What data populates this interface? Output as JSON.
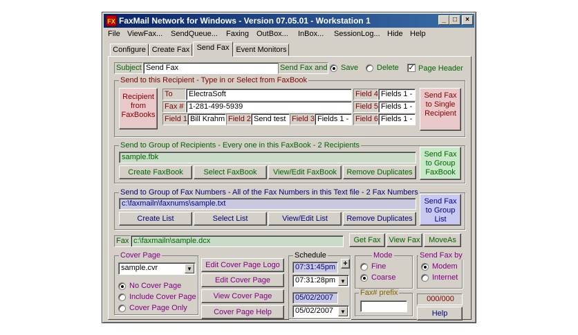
{
  "window": {
    "title": "FaxMail Network for Windows - Version 07.05.01 - Workstation 1",
    "icon": "FX"
  },
  "titlebar_buttons": {
    "minimize": "_",
    "maximize": "□",
    "close": "×"
  },
  "menu": [
    "File",
    "ViewFax...",
    "SendQueue...",
    "Faxing",
    "OutBox...",
    "InBox...",
    "SessionLog...",
    "Hide",
    "Help"
  ],
  "tabs": [
    "Configure",
    "Create Fax",
    "Send Fax",
    "Event Monitors"
  ],
  "subject": {
    "label": "Subject",
    "value": "Send Fax"
  },
  "send_fax_and": {
    "label": "Send Fax and",
    "save": "Save",
    "delete": "Delete",
    "page_header": "Page Header"
  },
  "recipient": {
    "legend": "Send to this Recipient - Type in or Select from FaxBook",
    "faxbooks_button": "Recipient from FaxBooks",
    "to_label": "To",
    "to_value": "ElectraSoft",
    "fax_label": "Fax #",
    "fax_value": "1-281-499-5939",
    "field1_label": "Field 1",
    "field1_value": "Bill Krahm",
    "field2_label": "Field 2",
    "field2_value": "Send test",
    "field3_label": "Field 3",
    "field3_value": "Fields 1 -",
    "field4_label": "Field 4",
    "field4_value": "Fields 1 -",
    "field5_label": "Field 5",
    "field5_value": "Fields 1 -",
    "field6_label": "Field 6",
    "field6_value": "Fields 1 -",
    "send_button": "Send Fax to Single Recipient"
  },
  "group": {
    "legend": "Send to Group of Recipients - Every one in this FaxBook - 2 Recipients",
    "file": "sample.fbk",
    "create": "Create FaxBook",
    "select": "Select FaxBook",
    "view_edit": "View/Edit FaxBook",
    "remove": "Remove Duplicates",
    "send_button": "Send Fax to Group FaxBook"
  },
  "numbers": {
    "legend": "Send to Group of Fax Numbers - All of the Fax Numbers in this Text file - 2 Fax Numbers",
    "file": "c:\\faxmailn\\faxnums\\sample.txt",
    "create": "Create List",
    "select": "Select List",
    "view_edit": "View/Edit List",
    "remove": "Remove Duplicates",
    "send_button": "Send Fax to Group List"
  },
  "fax": {
    "label": "Fax",
    "value": "c:\\faxmailn\\sample.dcx",
    "get": "Get Fax",
    "view": "View Fax",
    "move": "MoveAs"
  },
  "cover": {
    "legend": "Cover Page",
    "selected": "sample.cvr",
    "no_cover": "No Cover Page",
    "include": "Include Cover Page",
    "only": "Cover Page Only",
    "edit_logo": "Edit Cover Page Logo",
    "edit": "Edit Cover Page",
    "view": "View Cover Page",
    "help": "Cover Page Help"
  },
  "schedule": {
    "legend": "Schedule",
    "time_display": "07:31:45pm",
    "time_select": "07:31:28pm",
    "date_display": "05/02/2007",
    "date_select": "05/02/2007",
    "plus": "+"
  },
  "mode": {
    "legend": "Mode",
    "fine": "Fine",
    "coarse": "Coarse"
  },
  "fax_prefix": {
    "legend": "Fax# prefix",
    "value": ""
  },
  "send_by": {
    "legend": "Send Fax by",
    "modem": "Modem",
    "internet": "Internet"
  },
  "counter": "000/000",
  "help_button": "Help",
  "colors": {
    "title_start": "#0a246a",
    "title_end": "#3a6ea5",
    "send_single_bg": "#e8c8c8",
    "send_group_bg": "#c8e8c8",
    "send_list_bg": "#c8c8f0"
  }
}
